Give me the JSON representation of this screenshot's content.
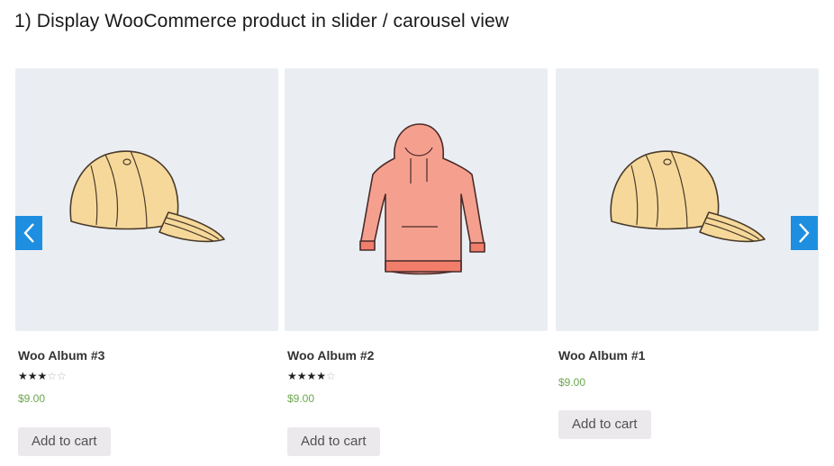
{
  "heading": "1) Display WooCommerce product in slider / carousel view",
  "colors": {
    "accent": "#1e8fe0",
    "price": "#6aa84f",
    "image_bg": "#eaeef3",
    "button_bg": "#ebe9eb"
  },
  "products": [
    {
      "title": "Woo Album #3",
      "image": "cap-icon",
      "rating": 3,
      "rating_max": 5,
      "price": "$9.00",
      "button": "Add to cart"
    },
    {
      "title": "Woo Album #2",
      "image": "hoodie-icon",
      "rating": 4,
      "rating_max": 5,
      "price": "$9.00",
      "button": "Add to cart"
    },
    {
      "title": "Woo Album #1",
      "image": "cap-icon",
      "rating": 0,
      "rating_max": 5,
      "price": "$9.00",
      "button": "Add to cart"
    }
  ],
  "navigation": {
    "prev_icon": "chevron-left-icon",
    "next_icon": "chevron-right-icon"
  }
}
